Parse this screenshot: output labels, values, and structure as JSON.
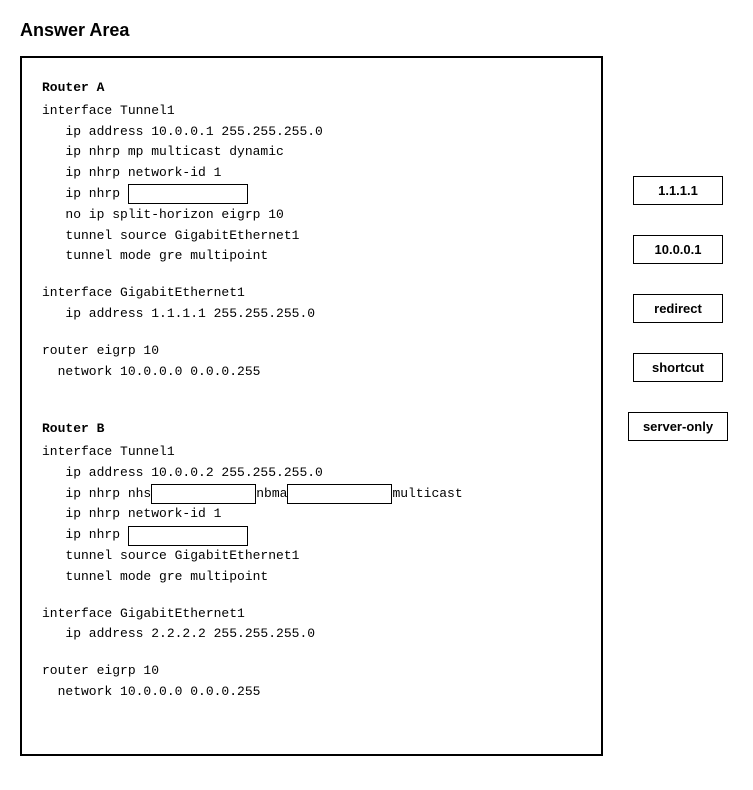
{
  "page": {
    "title": "Answer Area"
  },
  "answer_box": {
    "router_a_label": "Router A",
    "router_a_lines": [
      "interface Tunnel1",
      "   ip address 10.0.0.1 255.255.255.0",
      "   ip nhrp mp multicast dynamic",
      "   ip nhrp network-id 1",
      "   ip nhrp ",
      "   no ip split-horizon eigrp 10",
      "   tunnel source GigabitEthernet1",
      "   tunnel mode gre multipoint",
      "",
      "interface GigabitEthernet1",
      "   ip address 1.1.1.1 255.255.255.0",
      "",
      "router eigrp 10",
      "  network 10.0.0.0 0.0.0.255"
    ],
    "router_b_label": "Router B",
    "router_b_lines": [
      "interface Tunnel1",
      "   ip address 10.0.0.2 255.255.255.0",
      "   ip nhrp nhs        nbma          multicast",
      "   ip nhrp network-id 1",
      "   ip nhrp ",
      "   tunnel source GigabitEthernet1",
      "   tunnel mode gre multipoint",
      "",
      "interface GigabitEthernet1",
      "   ip address 2.2.2.2 255.255.255.0",
      "",
      "router eigrp 10",
      "  network 10.0.0.0 0.0.0.255"
    ]
  },
  "sidebar": {
    "options": [
      {
        "id": "opt-1111",
        "label": "1.1.1.1"
      },
      {
        "id": "opt-10001",
        "label": "10.0.0.1"
      },
      {
        "id": "opt-redirect",
        "label": "redirect"
      },
      {
        "id": "opt-shortcut",
        "label": "shortcut"
      },
      {
        "id": "opt-serveronly",
        "label": "server-only"
      }
    ]
  }
}
